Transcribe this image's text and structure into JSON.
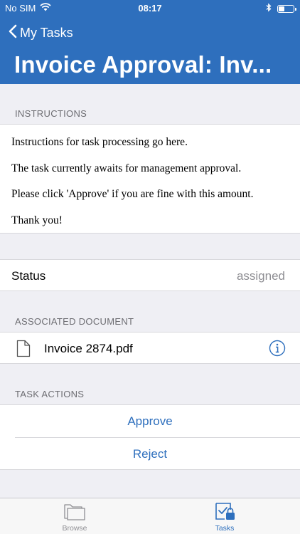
{
  "status_bar": {
    "carrier": "No SIM",
    "time": "08:17",
    "icons": [
      "wifi-icon",
      "bluetooth-icon",
      "battery-icon"
    ]
  },
  "nav": {
    "back_label": "My Tasks",
    "title": "Invoice Approval: Inv..."
  },
  "sections": {
    "instructions_header": "INSTRUCTIONS",
    "associated_document_header": "ASSOCIATED DOCUMENT",
    "task_actions_header": "TASK ACTIONS"
  },
  "instructions": {
    "lines": [
      "Instructions for task processing go here.",
      "The task currently awaits for management approval.",
      "Please click 'Approve' if you are fine with this amount.",
      "Thank you!"
    ]
  },
  "status": {
    "label": "Status",
    "value": "assigned"
  },
  "document": {
    "name": "Invoice 2874.pdf",
    "icon": "file-icon",
    "info_icon": "info-icon"
  },
  "actions": {
    "approve_label": "Approve",
    "reject_label": "Reject"
  },
  "tabbar": {
    "browse_label": "Browse",
    "tasks_label": "Tasks",
    "active": "Tasks"
  },
  "colors": {
    "accent": "#2e6fbd",
    "background": "#efeff4",
    "secondary_text": "#8e8e93",
    "tab_inactive": "#8e8e93"
  }
}
